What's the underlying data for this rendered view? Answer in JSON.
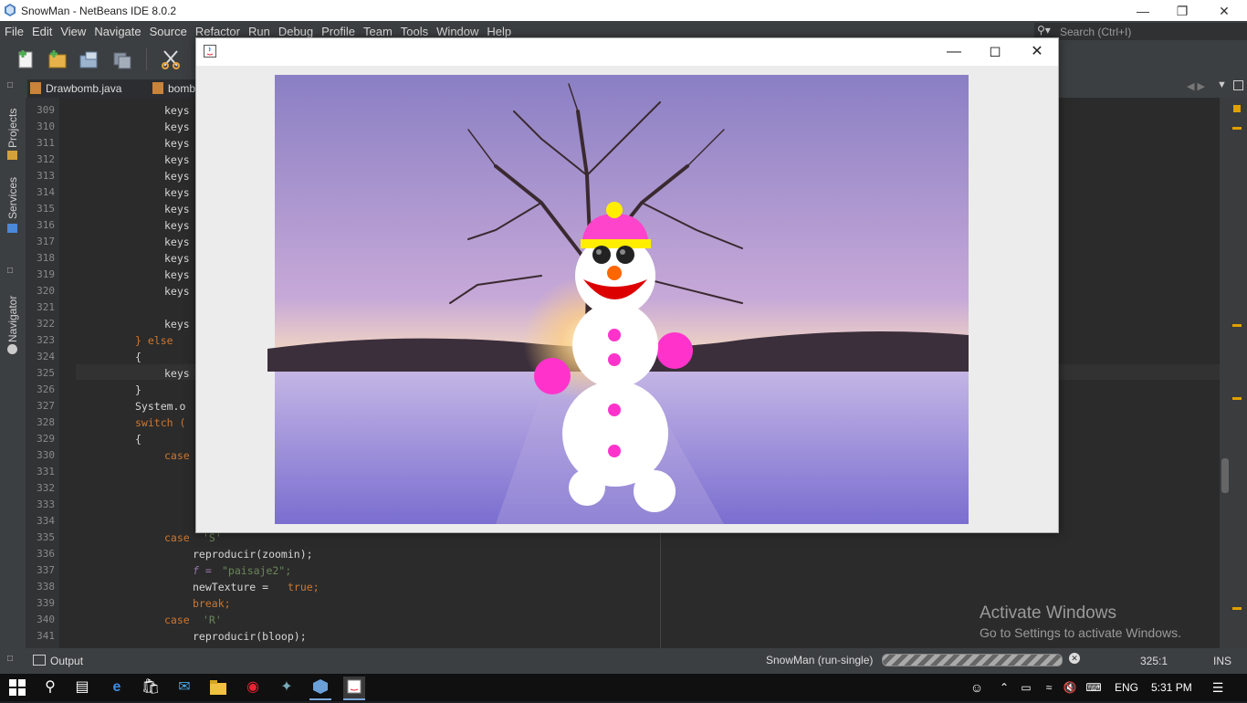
{
  "window_title": "SnowMan - NetBeans IDE 8.0.2",
  "menu": [
    "File",
    "Edit",
    "View",
    "Navigate",
    "Source",
    "Refactor",
    "Run",
    "Debug",
    "Profile",
    "Team",
    "Tools",
    "Window",
    "Help"
  ],
  "search_placeholder": "Search (Ctrl+I)",
  "tabs": [
    {
      "label": "Drawbomb.java"
    },
    {
      "label": "bomb"
    }
  ],
  "side_panel": [
    "Projects",
    "Services",
    "Navigator"
  ],
  "line_numbers": [
    "309",
    "310",
    "311",
    "312",
    "313",
    "314",
    "315",
    "316",
    "317",
    "318",
    "319",
    "320",
    "321",
    "322",
    "323",
    "324",
    "325",
    "326",
    "327",
    "328",
    "329",
    "330",
    "331",
    "332",
    "333",
    "334",
    "335",
    "336",
    "337",
    "338",
    "339",
    "340",
    "341"
  ],
  "code": {
    "keys": "keys",
    "else_text": "} else",
    "open_brace": "{",
    "close_brace": "}",
    "system": "System.o",
    "switch": "switch (",
    "case": "case",
    "case_s": "'S'",
    "reproducir_zoomin": "reproducir(zoomin);",
    "f_assign": "f = ",
    "paisaje2": "\"paisaje2\";",
    "newtexture": "newTexture = ",
    "true_text": "true;",
    "break_text": "break;",
    "case_r": "'R'",
    "reproducir_bloop": "reproducir(bloop);"
  },
  "output_tab": "Output",
  "run_status": "SnowMan (run-single)",
  "cursor_pos": "325:1",
  "insert_mode": "INS",
  "activate": {
    "title": "Activate Windows",
    "subtitle": "Go to Settings to activate Windows."
  },
  "taskbar": {
    "lang": "ENG",
    "time": "5:31 PM"
  },
  "colors": {
    "hat": "#ff44cc",
    "hat_band": "#ffee00",
    "nose": "#ff6600",
    "mouth": "#dd0000",
    "buttons": "#ff33cc",
    "sky_top": "#8a7fc4",
    "snow": "#a49ae0"
  }
}
